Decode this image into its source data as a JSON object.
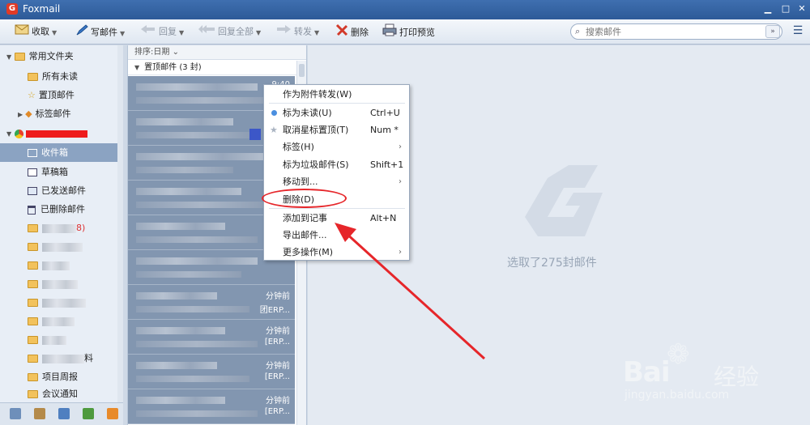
{
  "window": {
    "title": "Foxmail",
    "logo_letter": "G",
    "min_glyph": "▁",
    "max_glyph": "□",
    "close_glyph": "✕"
  },
  "toolbar": {
    "receive": "收取",
    "compose": "写邮件",
    "reply": "回复",
    "reply_all": "回复全部",
    "forward": "转发",
    "delete": "删除",
    "print_preview": "打印预览",
    "search_placeholder": "搜索邮件",
    "dropdown_glyph": "▼"
  },
  "sidebar": {
    "groups": [
      {
        "label": "常用文件夹",
        "items": [
          "所有未读",
          "置顶邮件",
          "标签邮件"
        ]
      }
    ],
    "account_items": [
      "收件箱",
      "草稿箱",
      "已发送邮件",
      "已删除邮件"
    ],
    "blurred_badge": "8)",
    "blurred_suffix": "料",
    "bottom_folders": [
      "项目周报",
      "会议通知"
    ]
  },
  "list": {
    "sort_label": "排序:日期",
    "pinned_header": "置顶邮件 (3 封)",
    "row_times": [
      "9:40",
      "",
      "",
      "",
      "",
      "",
      "分钟前",
      "分钟前",
      "分钟前",
      "分钟前"
    ],
    "row_snippets": [
      "",
      "",
      "",
      "",
      "",
      "",
      "团ERP...",
      "[ERP...",
      "[ERP...",
      "[ERP..."
    ]
  },
  "context_menu": {
    "items": [
      {
        "label": "作为附件转发(W)",
        "shortcut": "",
        "submenu": false
      },
      {
        "label": "标为未读(U)",
        "shortcut": "Ctrl+U",
        "submenu": false
      },
      {
        "label": "取消星标置顶(T)",
        "shortcut": "Num *",
        "submenu": false
      },
      {
        "label": "标签(H)",
        "shortcut": "",
        "submenu": true
      },
      {
        "label": "标为垃圾邮件(S)",
        "shortcut": "Shift+1",
        "submenu": false
      },
      {
        "label": "移动到...",
        "shortcut": "",
        "submenu": true
      },
      {
        "label": "删除(D)",
        "shortcut": "",
        "submenu": false
      },
      {
        "label": "添加到记事",
        "shortcut": "Alt+N",
        "submenu": false
      },
      {
        "label": "导出邮件...",
        "shortcut": "",
        "submenu": false
      },
      {
        "label": "更多操作(M)",
        "shortcut": "",
        "submenu": true
      }
    ]
  },
  "preview": {
    "selection_text": "选取了275封邮件"
  },
  "watermark": {
    "brand": "Bai",
    "brand2": "经验",
    "url": "jingyan.baidu.com"
  },
  "colors": {
    "highlight_ring": "#e6262a",
    "selected_folder": "#8ba3c2",
    "list_rows": "#8296b0"
  }
}
